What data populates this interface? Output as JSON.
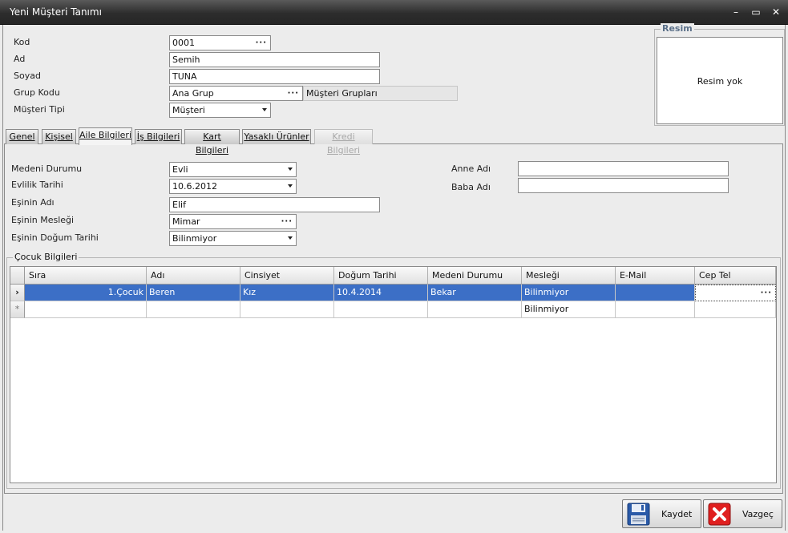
{
  "window": {
    "title": "Yeni Müşteri Tanımı",
    "min": "–",
    "max": "▭",
    "close": "✕"
  },
  "header": {
    "kod_label": "Kod",
    "kod_value": "0001",
    "ad_label": "Ad",
    "ad_value": "Semih",
    "soyad_label": "Soyad",
    "soyad_value": "TUNA",
    "grup_label": "Grup Kodu",
    "grup_value": "Ana Grup",
    "grup_desc": "Müşteri Grupları",
    "tip_label": "Müşteri Tipi",
    "tip_value": "Müşteri",
    "ellipsis": "···"
  },
  "image": {
    "legend": "Resim",
    "placeholder": "Resim yok"
  },
  "tabs": [
    {
      "label": "Genel"
    },
    {
      "label": "Kişisel"
    },
    {
      "label": "Aile Bilgileri"
    },
    {
      "label": "İş Bilgileri"
    },
    {
      "label": "Kart Bilgileri"
    },
    {
      "label": "Yasaklı Ürünler"
    },
    {
      "label": "Kredi Bilgileri"
    }
  ],
  "family": {
    "medeni_label": "Medeni Durumu",
    "medeni_value": "Evli",
    "evlilik_label": "Evlilik Tarihi",
    "evlilik_value": "10.6.2012",
    "es_adi_label": "Eşinin Adı",
    "es_adi_value": "Elif",
    "es_meslek_label": "Eşinin Mesleği",
    "es_meslek_value": "Mimar",
    "es_dogum_label": "Eşinin Doğum Tarihi",
    "es_dogum_value": "Bilinmiyor",
    "anne_label": "Anne Adı",
    "anne_value": "",
    "baba_label": "Baba Adı",
    "baba_value": ""
  },
  "children": {
    "legend": "Çocuk Bilgileri",
    "columns": [
      "Sıra",
      "Adı",
      "Cinsiyet",
      "Doğum Tarihi",
      "Medeni Durumu",
      "Mesleği",
      "E-Mail",
      "Cep Tel"
    ],
    "rows": [
      {
        "indicator": "›",
        "sira": "1.Çocuk",
        "adi": "Beren",
        "cinsiyet": "Kız",
        "dogum": "10.4.2014",
        "medeni": "Bekar",
        "meslek": "Bilinmiyor",
        "email": "",
        "cep": ""
      }
    ],
    "new_row": {
      "indicator": "*",
      "meslek": "Bilinmiyor"
    }
  },
  "buttons": {
    "save": "Kaydet",
    "cancel": "Vazgeç"
  },
  "colors": {
    "titlebar": "#2d2d2d",
    "selection": "#3c6fc6",
    "legend": "#5a6f88",
    "cancel_red": "#e02020"
  }
}
